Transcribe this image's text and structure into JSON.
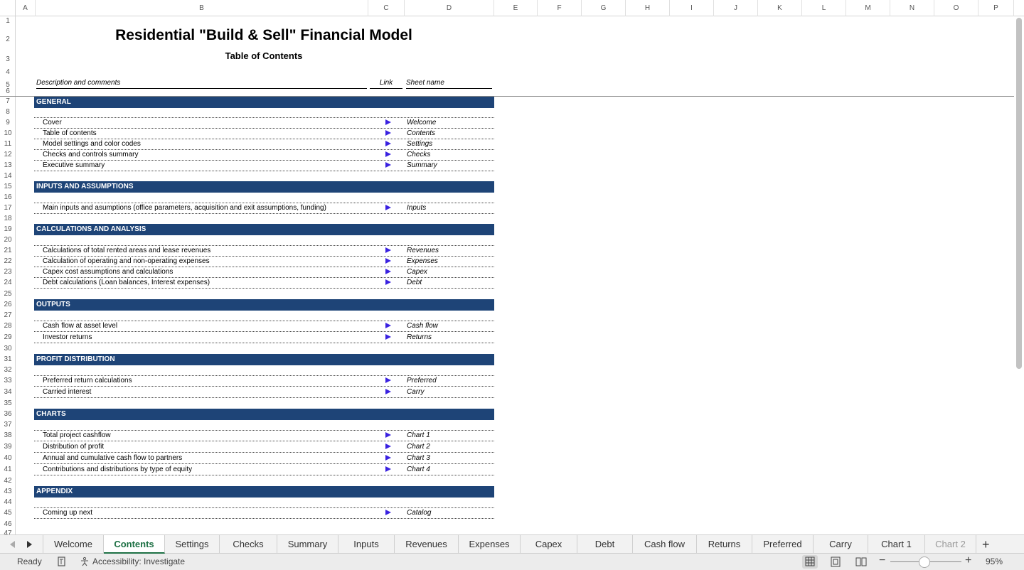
{
  "columns": [
    "A",
    "B",
    "C",
    "D",
    "E",
    "F",
    "G",
    "H",
    "I",
    "J",
    "K",
    "L",
    "M",
    "N",
    "O",
    "P"
  ],
  "rows": [
    "1",
    "2",
    "3",
    "4",
    "5",
    "6",
    "7",
    "8",
    "9",
    "10",
    "11",
    "12",
    "13",
    "14",
    "15",
    "16",
    "17",
    "18",
    "19",
    "20",
    "21",
    "22",
    "23",
    "24",
    "25",
    "26",
    "27",
    "28",
    "29",
    "30",
    "31",
    "32",
    "33",
    "34",
    "35",
    "36",
    "37",
    "38",
    "39",
    "40",
    "41",
    "42",
    "43",
    "44",
    "45",
    "46",
    "47"
  ],
  "sheet": {
    "title": "Residential \"Build & Sell\" Financial Model",
    "subtitle": "Table of Contents",
    "col_desc": "Description and comments",
    "col_link": "Link",
    "col_sheet": "Sheet name"
  },
  "sections": [
    {
      "title": "GENERAL",
      "items": [
        {
          "desc": "Cover",
          "sheet": "Welcome"
        },
        {
          "desc": "Table of contents",
          "sheet": "Contents"
        },
        {
          "desc": "Model settings and color codes",
          "sheet": "Settings"
        },
        {
          "desc": "Checks and controls summary",
          "sheet": "Checks"
        },
        {
          "desc": "Executive summary",
          "sheet": "Summary"
        }
      ]
    },
    {
      "title": "INPUTS AND ASSUMPTIONS",
      "items": [
        {
          "desc": "Main inputs and asumptions (office parameters, acquisition and exit assumptions, funding)",
          "sheet": "Inputs"
        }
      ]
    },
    {
      "title": "CALCULATIONS AND ANALYSIS",
      "items": [
        {
          "desc": "Calculations of total rented areas and lease revenues",
          "sheet": "Revenues"
        },
        {
          "desc": "Calculation of operating and non-operating expenses",
          "sheet": "Expenses"
        },
        {
          "desc": "Capex cost assumptions and calculations",
          "sheet": "Capex"
        },
        {
          "desc": "Debt calculations (Loan balances, Interest expenses)",
          "sheet": "Debt"
        }
      ]
    },
    {
      "title": "OUTPUTS",
      "items": [
        {
          "desc": "Cash flow at asset level",
          "sheet": "Cash flow"
        },
        {
          "desc": "Investor returns",
          "sheet": "Returns"
        }
      ]
    },
    {
      "title": "PROFIT DISTRIBUTION",
      "items": [
        {
          "desc": "Preferred return calculations",
          "sheet": "Preferred"
        },
        {
          "desc": "Carried interest",
          "sheet": "Carry"
        }
      ]
    },
    {
      "title": "CHARTS",
      "items": [
        {
          "desc": "Total project cashflow",
          "sheet": "Chart 1"
        },
        {
          "desc": "Distribution of profit",
          "sheet": "Chart 2"
        },
        {
          "desc": "Annual and cumulative cash flow to partners",
          "sheet": "Chart 3"
        },
        {
          "desc": "Contributions and distributions by type of equity",
          "sheet": "Chart 4"
        }
      ]
    },
    {
      "title": "APPENDIX",
      "items": [
        {
          "desc": "Coming up next",
          "sheet": "Catalog"
        }
      ]
    }
  ],
  "tabs": [
    "Welcome",
    "Contents",
    "Settings",
    "Checks",
    "Summary",
    "Inputs",
    "Revenues",
    "Expenses",
    "Capex",
    "Debt",
    "Cash flow",
    "Returns",
    "Preferred",
    "Carry",
    "Chart 1",
    "Chart 2"
  ],
  "active_tab": "Contents",
  "status": {
    "ready": "Ready",
    "accessibility": "Accessibility: Investigate",
    "zoom": "95%"
  },
  "colors": {
    "section_band": "#1e4477",
    "link_arrow": "#3a22e0",
    "active_tab": "#1d7044"
  }
}
